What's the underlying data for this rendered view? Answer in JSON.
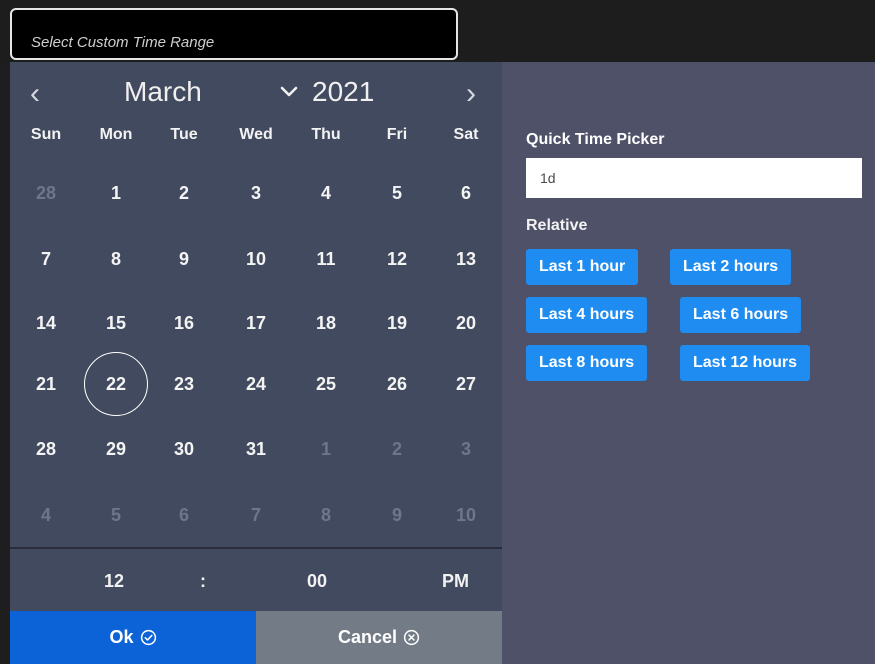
{
  "range_input": {
    "placeholder": "Select Custom Time Range"
  },
  "calendar": {
    "prev_glyph": "‹",
    "next_glyph": "›",
    "month": "March",
    "year": "2021",
    "weekdays": [
      "Sun",
      "Mon",
      "Tue",
      "Wed",
      "Thu",
      "Fri",
      "Sat"
    ],
    "weeks": [
      [
        "28",
        "1",
        "2",
        "3",
        "4",
        "5",
        "6"
      ],
      [
        "7",
        "8",
        "9",
        "10",
        "11",
        "12",
        "13"
      ],
      [
        "14",
        "15",
        "16",
        "17",
        "18",
        "19",
        "20"
      ],
      [
        "21",
        "22",
        "23",
        "24",
        "25",
        "26",
        "27"
      ],
      [
        "28",
        "29",
        "30",
        "31",
        "1",
        "2",
        "3"
      ],
      [
        "4",
        "5",
        "6",
        "7",
        "8",
        "9",
        "10"
      ]
    ],
    "outside_month": [
      [
        true,
        false,
        false,
        false,
        false,
        false,
        false
      ],
      [
        false,
        false,
        false,
        false,
        false,
        false,
        false
      ],
      [
        false,
        false,
        false,
        false,
        false,
        false,
        false
      ],
      [
        false,
        false,
        false,
        false,
        false,
        false,
        false
      ],
      [
        false,
        false,
        false,
        false,
        true,
        true,
        true
      ],
      [
        true,
        true,
        true,
        true,
        true,
        true,
        true
      ]
    ],
    "today": {
      "week": 3,
      "day": 1
    }
  },
  "time": {
    "hour": "12",
    "separator": ":",
    "minute": "00",
    "meridiem": "PM"
  },
  "buttons": {
    "ok_label": "Ok",
    "cancel_label": "Cancel"
  },
  "quick_picker": {
    "label": "Quick Time Picker",
    "value": "1d",
    "relative_label": "Relative",
    "options": [
      "Last 1 hour",
      "Last 2 hours",
      "Last 4 hours",
      "Last 6 hours",
      "Last 8 hours",
      "Last 12 hours"
    ]
  },
  "colors": {
    "calendar_bg": "#414a5e",
    "side_bg": "#4e5167",
    "ok_bg": "#0c63d7",
    "cancel_bg": "#727b86",
    "chip_bg": "#1e8cf0"
  }
}
